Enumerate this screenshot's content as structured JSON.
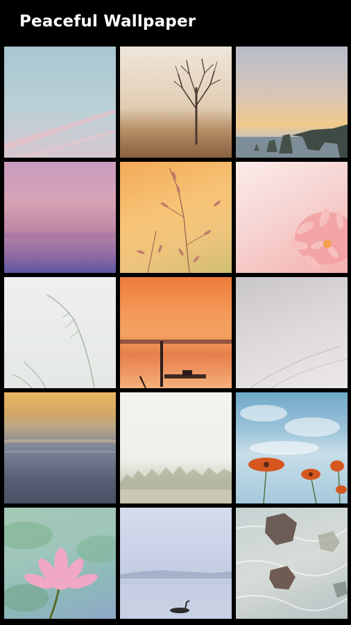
{
  "app": {
    "title": "Peaceful Wallpaper"
  },
  "wallpapers": [
    {
      "name": "pastel-sky-streaks"
    },
    {
      "name": "lone-tree-fog"
    },
    {
      "name": "sea-stacks-sunset"
    },
    {
      "name": "purple-gradient-horizon"
    },
    {
      "name": "golden-grass-stems"
    },
    {
      "name": "pink-dahlia-closeup"
    },
    {
      "name": "white-feather-grass"
    },
    {
      "name": "orange-lake-sunset"
    },
    {
      "name": "grey-mist-grass"
    },
    {
      "name": "blurred-ocean-dusk"
    },
    {
      "name": "misty-forest-treeline"
    },
    {
      "name": "orange-daisies-sky"
    },
    {
      "name": "pink-water-lily"
    },
    {
      "name": "swan-misty-lake"
    },
    {
      "name": "river-rocks-water"
    }
  ]
}
